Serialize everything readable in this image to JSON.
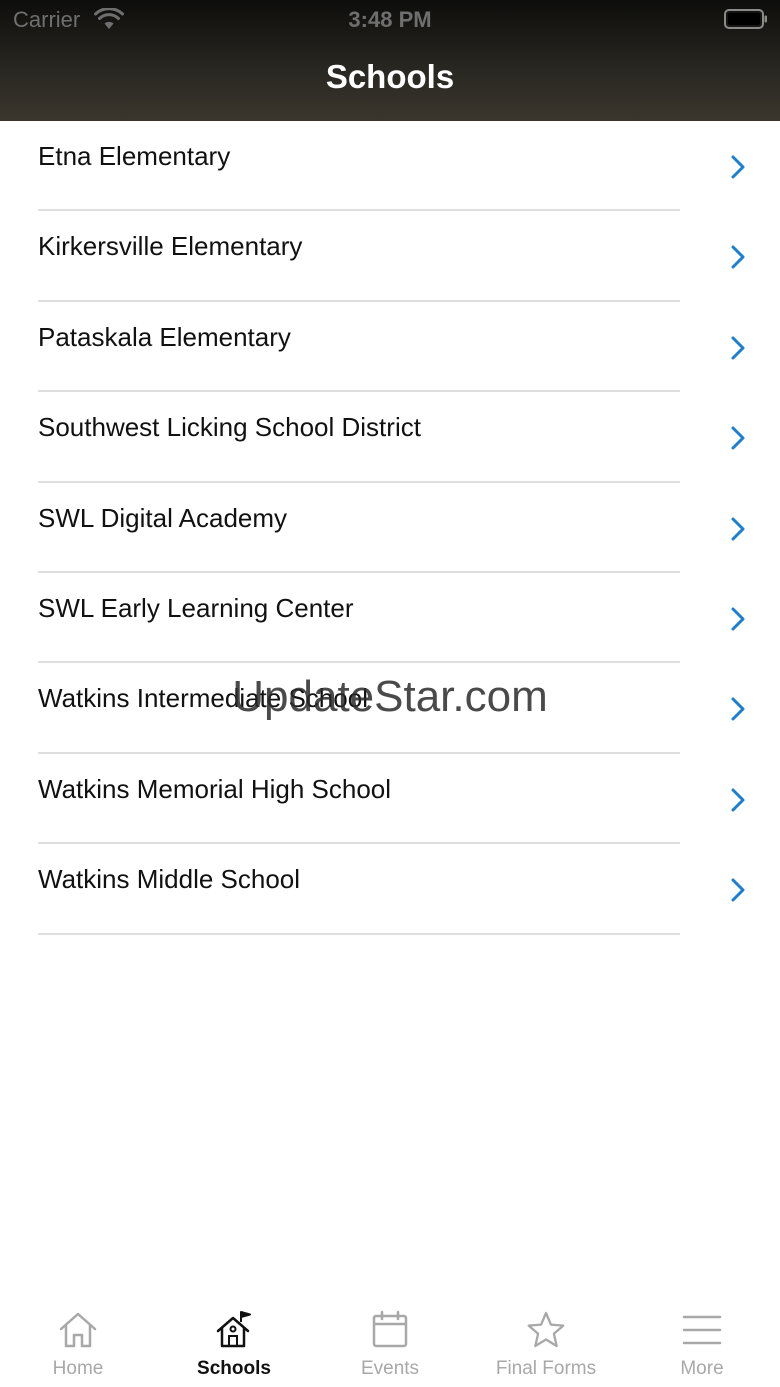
{
  "status_bar": {
    "carrier": "Carrier",
    "time": "3:48 PM"
  },
  "header": {
    "title": "Schools"
  },
  "schools": [
    {
      "name": "Etna Elementary"
    },
    {
      "name": "Kirkersville Elementary"
    },
    {
      "name": "Pataskala Elementary"
    },
    {
      "name": "Southwest Licking School District"
    },
    {
      "name": "SWL Digital Academy"
    },
    {
      "name": "SWL Early Learning Center"
    },
    {
      "name": "Watkins Intermediate School"
    },
    {
      "name": "Watkins Memorial High School"
    },
    {
      "name": "Watkins Middle School"
    }
  ],
  "watermark": "UpdateStar.com",
  "tab_bar": {
    "tabs": [
      {
        "label": "Home",
        "icon": "home-icon",
        "active": false
      },
      {
        "label": "Schools",
        "icon": "school-flag-icon",
        "active": true
      },
      {
        "label": "Events",
        "icon": "calendar-icon",
        "active": false
      },
      {
        "label": "Final Forms",
        "icon": "star-icon",
        "active": false
      },
      {
        "label": "More",
        "icon": "menu-icon",
        "active": false
      }
    ]
  },
  "colors": {
    "accent": "#1a7fd4",
    "header_dark": "#0d0d0b",
    "tab_inactive": "#a8a8a8"
  }
}
